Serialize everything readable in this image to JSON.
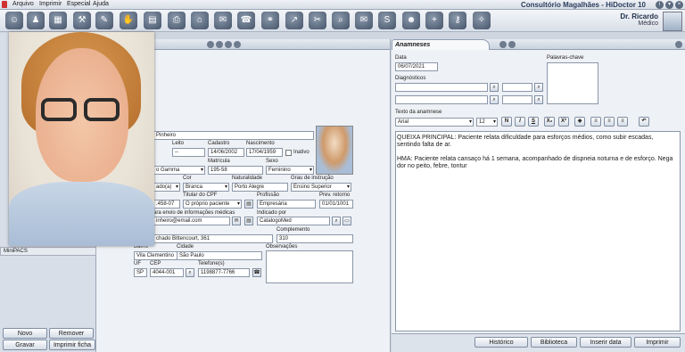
{
  "app": {
    "title": "Consultório Magalhães - HiDoctor 10"
  },
  "menu": [
    "Arquivo",
    "Imprimir",
    "Especial",
    "Ajuda"
  ],
  "toolbar_icons": [
    "user-icon",
    "group-icon",
    "calendar-icon",
    "tools-icon",
    "edit-icon",
    "handshake-icon",
    "book-icon",
    "print-icon",
    "home-icon",
    "chat-icon",
    "phone-icon",
    "binoculars-icon",
    "export-icon",
    "scissors-icon",
    "search-icon",
    "mail-icon",
    "s-icon",
    "mask-icon",
    "add-icon",
    "key-icon",
    "compass-icon"
  ],
  "user": {
    "name": "Dr. Ricardo",
    "role": "Médico"
  },
  "left": {
    "minipacs": "MiniPACS",
    "buttons": {
      "novo": "Novo",
      "remover": "Remover",
      "gravar": "Gravar",
      "imprimir": "Imprimir ficha"
    }
  },
  "patient": {
    "name": "Pinheiro",
    "labels": {
      "leito": "Leito",
      "cadastro": "Cadastro",
      "nascimento": "Nascimento",
      "matricula": "Matrícula",
      "sexo": "Sexo",
      "cor": "Cor",
      "naturalidade": "Naturalidade",
      "grau": "Grau de instrução",
      "titular": "Titular do CPF",
      "profissao": "Profissão",
      "prev_retorno": "Prev. retorno",
      "envio": "ara envio de informações médicas",
      "indicado": "Indicado por",
      "complemento": "Complemento",
      "bairro": "Bairro",
      "cidade": "Cidade",
      "observacoes": "Observações",
      "uf": "UF",
      "cep": "CEP",
      "telefones": "Telefone(s)",
      "inativo": "Inativo"
    },
    "leito": "--",
    "cadastro": "14/06/2002",
    "nascimento": "17/04/1959",
    "plano": "o Gamma",
    "matricula": "195-58",
    "sexo": "Feminino",
    "estado_civil": "ado(a)",
    "cor": "Branca",
    "naturalidade": "Porto Alegre",
    "grau": "Ensino Superior",
    "cpf": ".458-07",
    "titular": "O próprio paciente",
    "profissao": "Empresária",
    "prev_retorno": "01/01/1001",
    "email": "inheiro@email.com",
    "indicado": "CatalogoMed",
    "endereco": "chado Bittencourt, 361",
    "complemento": "310",
    "bairro": "Vila Clementino",
    "cidade": "São Paulo",
    "uf": "SP",
    "cep": "4044-001",
    "telefone": "1198877-7766"
  },
  "anamnese": {
    "tab": "Anamneses",
    "data_label": "Data",
    "data": "06/07/2021",
    "palavras_label": "Palavras-chave",
    "diagnosticos_label": "Diagnósticos",
    "texto_label": "Texto da anamnese",
    "font": "Arial",
    "size": "12",
    "text": [
      "QUEIXA PRINCIPAL: Paciente relata dificuldade para esforços médios, como subir escadas, sentindo falta de ar.",
      "HMA: Paciente relata cansaço há 1 semana, acompanhado de dispneia noturna e de esforço. Nega dor no peito, febre, tontur"
    ],
    "buttons": {
      "historico": "Histórico",
      "biblioteca": "Biblioteca",
      "inserir": "Inserir data",
      "imprimir": "Imprimir"
    }
  }
}
